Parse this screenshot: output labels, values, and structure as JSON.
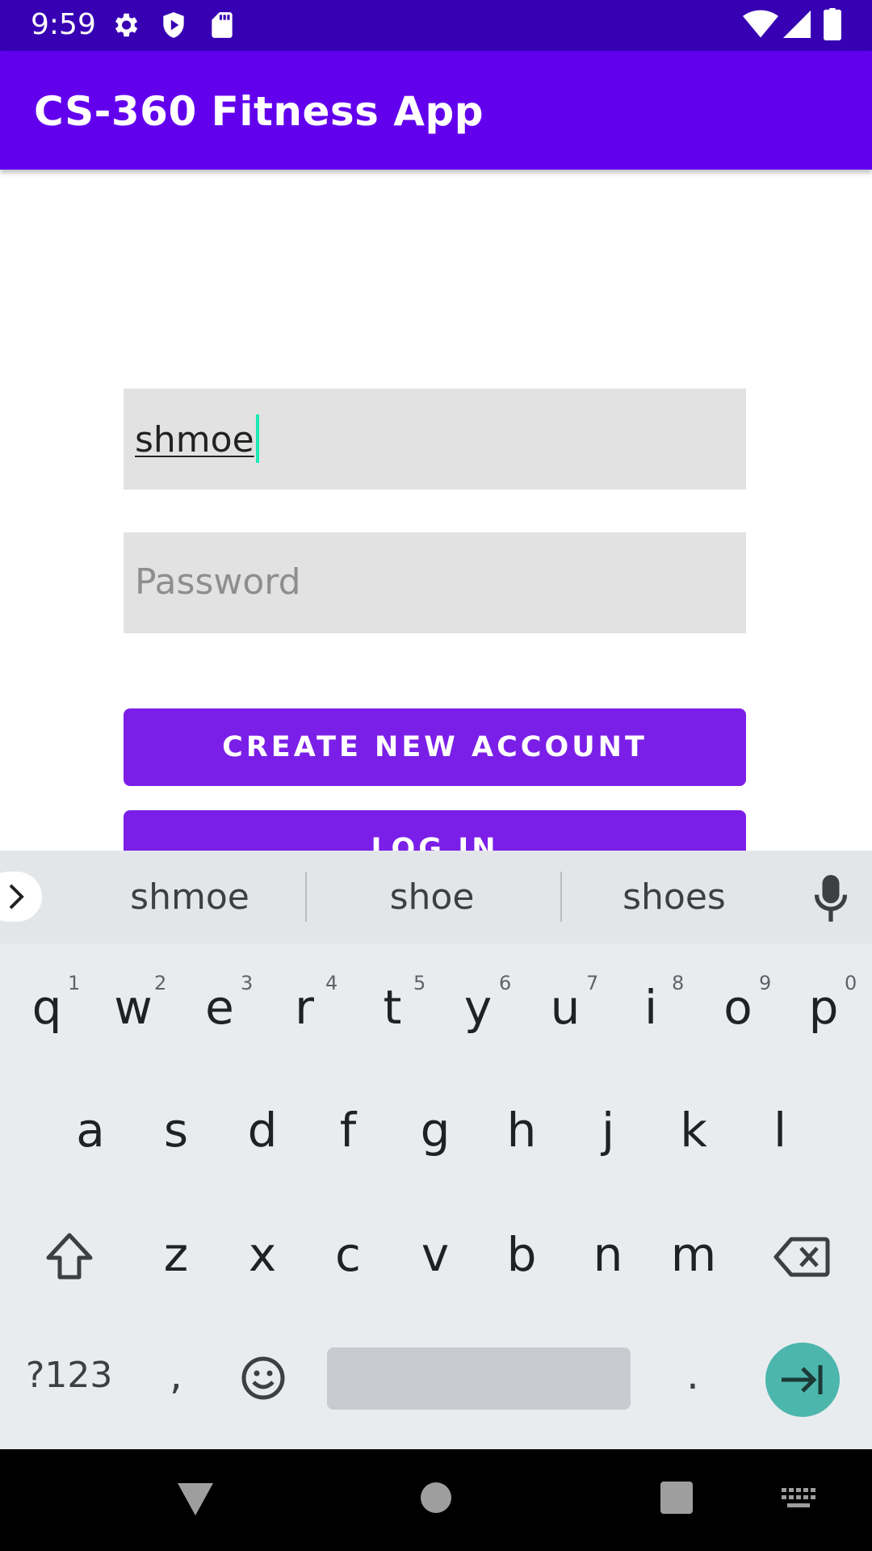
{
  "status_bar": {
    "time": "9:59",
    "icons": [
      "gear-icon",
      "shield-play-icon",
      "sd-card-icon",
      "wifi-icon",
      "signal-icon",
      "battery-icon"
    ]
  },
  "app_bar": {
    "title": "CS-360 Fitness App",
    "color": "#6200ee"
  },
  "form": {
    "username_value": "shmoe",
    "password_placeholder": "Password",
    "create_account_label": "CREATE NEW ACCOUNT",
    "login_label": "LOG IN",
    "accent": "#7b1fe8"
  },
  "keyboard": {
    "suggestions": [
      "shmoe",
      "shoe",
      "shoes"
    ],
    "row1": [
      "q",
      "w",
      "e",
      "r",
      "t",
      "y",
      "u",
      "i",
      "o",
      "p"
    ],
    "row1_hints": [
      "1",
      "2",
      "3",
      "4",
      "5",
      "6",
      "7",
      "8",
      "9",
      "0"
    ],
    "row2": [
      "a",
      "s",
      "d",
      "f",
      "g",
      "h",
      "j",
      "k",
      "l"
    ],
    "row3": [
      "z",
      "x",
      "c",
      "v",
      "b",
      "n",
      "m"
    ],
    "symbols_label": "?123",
    "comma": ",",
    "period": ".",
    "enter_color": "#4db6ac"
  },
  "nav_bar": {
    "icons": [
      "back-triangle-icon",
      "home-circle-icon",
      "recents-square-icon",
      "keyboard-switch-icon"
    ]
  }
}
